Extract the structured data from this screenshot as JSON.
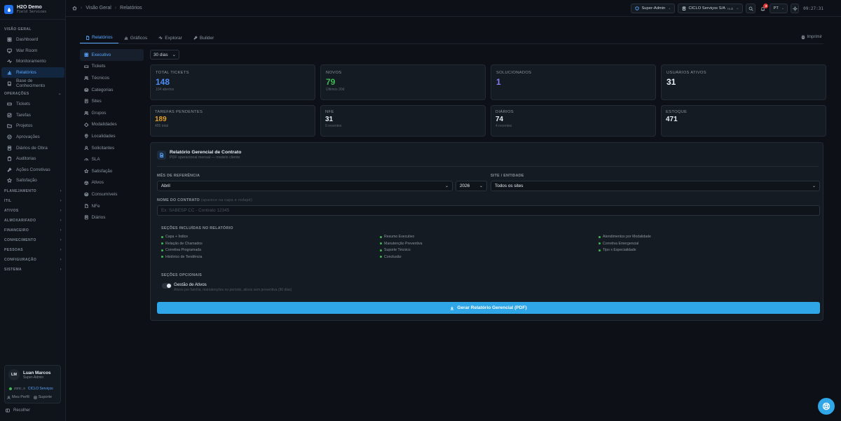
{
  "app": {
    "name": "H2O Demo",
    "subtitle": "Field Services"
  },
  "sidebar": {
    "sections": [
      {
        "label": "VISÃO GERAL",
        "items": [
          {
            "label": "Dashboard",
            "icon": "grid-icon"
          },
          {
            "label": "War Room",
            "icon": "monitor-icon"
          },
          {
            "label": "Monitoramento",
            "icon": "activity-icon"
          },
          {
            "label": "Relatórios",
            "icon": "bar-chart-icon",
            "active": true
          },
          {
            "label": "Base de Conhecimento",
            "icon": "book-icon"
          }
        ]
      },
      {
        "label": "OPERAÇÕES",
        "items": [
          {
            "label": "Tickets",
            "icon": "ticket-icon"
          },
          {
            "label": "Tarefas",
            "icon": "checklist-icon"
          },
          {
            "label": "Projetos",
            "icon": "folder-icon"
          },
          {
            "label": "Aprovações",
            "icon": "check-circle-icon"
          },
          {
            "label": "Diários de Obra",
            "icon": "notebook-icon"
          },
          {
            "label": "Auditorias",
            "icon": "clipboard-icon"
          },
          {
            "label": "Ações Corretivas",
            "icon": "wrench-icon"
          },
          {
            "label": "Satisfação",
            "icon": "star-icon"
          }
        ]
      }
    ],
    "collapsed_sections": [
      "PLANEJAMENTO",
      "ITIL",
      "ATIVOS",
      "ALMOXARIFADO",
      "FINANCEIRO",
      "CONHECIMENTO",
      "PESSOAS",
      "CONFIGURAÇÃO",
      "SISTEMA"
    ],
    "user": {
      "initials": "LM",
      "name": "Luan Marcos",
      "role": "Super-Admin",
      "status": "zonc..s",
      "org": "CICLO Serviços",
      "profile_label": "Meu Perfil",
      "support_label": "Suporte"
    },
    "collapse_label": "Recolher"
  },
  "breadcrumb": [
    "Visão Geral",
    "Relatórios"
  ],
  "topbar": {
    "role": "Super-Admin",
    "org": "CICLO Serviços S/A",
    "org_tag": "Hub",
    "notifications": "3",
    "lang": "PT",
    "clock": "09:27:31"
  },
  "tabs": [
    {
      "label": "Relatórios",
      "icon": "file-icon",
      "active": true
    },
    {
      "label": "Gráficos",
      "icon": "bar-chart-icon"
    },
    {
      "label": "Explorar",
      "icon": "activity-icon"
    },
    {
      "label": "Builder",
      "icon": "wrench-icon"
    }
  ],
  "print_label": "Imprimir",
  "subnav": [
    {
      "label": "Executivo",
      "icon": "grid-icon",
      "active": true
    },
    {
      "label": "Tickets",
      "icon": "ticket-icon"
    },
    {
      "label": "Técnicos",
      "icon": "users-icon"
    },
    {
      "label": "Categorias",
      "icon": "layers-icon"
    },
    {
      "label": "Sites",
      "icon": "building-icon"
    },
    {
      "label": "Grupos",
      "icon": "users-icon"
    },
    {
      "label": "Modalidades",
      "icon": "diamond-icon"
    },
    {
      "label": "Localidades",
      "icon": "pin-icon"
    },
    {
      "label": "Solicitantes",
      "icon": "user-icon"
    },
    {
      "label": "SLA",
      "icon": "gauge-icon"
    },
    {
      "label": "Satisfação",
      "icon": "star-icon"
    },
    {
      "label": "Ativos",
      "icon": "box-icon"
    },
    {
      "label": "Consumíveis",
      "icon": "layers-icon"
    },
    {
      "label": "NFe",
      "icon": "file-icon"
    },
    {
      "label": "Diários",
      "icon": "notebook-icon"
    }
  ],
  "period": "30 dias",
  "kpis": [
    {
      "label": "TOTAL TICKETS",
      "value": "148",
      "sub": "104 abertos",
      "color": "#4c8df6"
    },
    {
      "label": "NOVOS",
      "value": "79",
      "sub": "Últimos 30d",
      "color": "#3fb950"
    },
    {
      "label": "SOLUCIONADOS",
      "value": "1",
      "sub": "",
      "color": "#8b7cf6"
    },
    {
      "label": "USUÁRIOS ATIVOS",
      "value": "31",
      "sub": "",
      "color": "#e6edf3"
    }
  ],
  "kpis2": [
    {
      "label": "TAREFAS PENDENTES",
      "value": "189",
      "sub": "455 total",
      "color": "#e3a02a"
    },
    {
      "label": "NFE",
      "value": "31",
      "sub": "0 recentes",
      "color": "#e6edf3"
    },
    {
      "label": "DIÁRIOS",
      "value": "74",
      "sub": "4 recentes",
      "color": "#e6edf3"
    },
    {
      "label": "ESTOQUE",
      "value": "471",
      "sub": "",
      "color": "#e6edf3"
    }
  ],
  "report": {
    "title": "Relatório Gerencial de Contrato",
    "subtitle": "PDF operacional mensal — modelo cliente",
    "month_label": "MÊS DE REFERÊNCIA",
    "month_value": "Abril",
    "year_value": "2026",
    "site_label": "SITE / ENTIDADE",
    "site_value": "Todos os sites",
    "contract_label": "NOME DO CONTRATO",
    "contract_hint": "(aparece na capa e rodapé)",
    "contract_placeholder": "Ex: SABESP CC - Contrato 12345",
    "sections_label": "SEÇÕES INCLUÍDAS NO RELATÓRIO",
    "sections_col1": [
      "Capa + Índice",
      "Relação de Chamados",
      "Corretiva Programada",
      "Histórico de Tendência"
    ],
    "sections_col2": [
      "Resumo Executivo",
      "Manutenção Preventiva",
      "Suporte Técnico",
      "Conclusão"
    ],
    "sections_col3": [
      "Atendimentos por Modalidade",
      "Corretiva Emergencial",
      "Tipo x Especialidade"
    ],
    "optional_label": "SEÇÕES OPCIONAIS",
    "optional_title": "Gestão de Ativos",
    "optional_desc": "Ativos por família, manutenções no período, ativos sem preventiva (90 dias)",
    "generate_label": "Gerar Relatório Gerencial (PDF)"
  }
}
